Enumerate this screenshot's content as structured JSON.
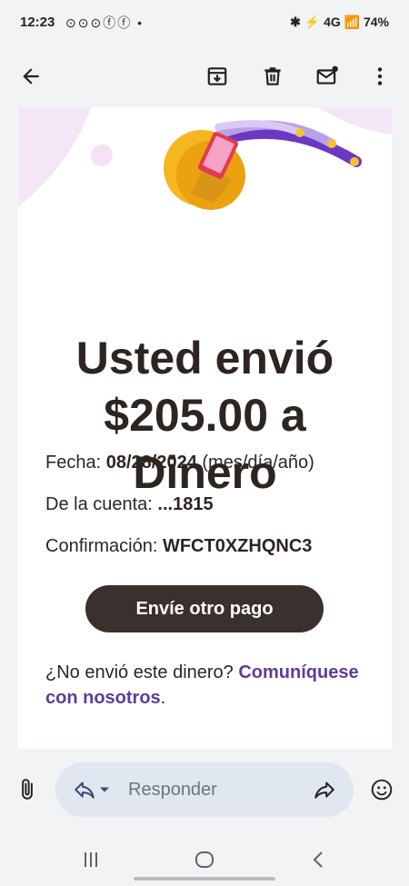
{
  "status_bar": {
    "time": "12:23",
    "notifications": "⊙⊙⊙ⓕⓕ •",
    "right": "✱ ⚡ 4G 📶 74%"
  },
  "toolbar": {
    "icons": [
      "back-arrow-icon",
      "archive-icon",
      "delete-icon",
      "mark-unread-icon",
      "more-options-icon"
    ]
  },
  "email": {
    "headline_line1": "Usted envió",
    "headline_line2": "$205.00 a",
    "headline_line3": "Dinero",
    "date_label": "Fecha:",
    "date_value": "08/28/2024",
    "date_format": "(mes/día/año)",
    "account_label": "De la cuenta:",
    "account_value": "...1815",
    "confirmation_label": "Confirmación:",
    "confirmation_value": "WFCT0XZHQNC3",
    "cta_label": "Envíe otro pago",
    "help_text": "¿No envió este dinero?",
    "help_link": "Comuníquese con nosotros",
    "help_end": "."
  },
  "reply_bar": {
    "placeholder": "Responder"
  },
  "colors": {
    "cta": "#3a302d",
    "link": "#5a3e9a",
    "reply_pill": "#e0e7f1",
    "background": "#f1f3f4"
  }
}
